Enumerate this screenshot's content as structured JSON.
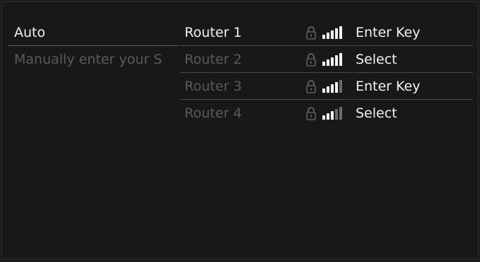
{
  "left_menu": {
    "items": [
      {
        "label": "Auto"
      },
      {
        "label": "Manually enter your S"
      }
    ]
  },
  "networks": [
    {
      "name": "Router 1",
      "action": "Enter Key",
      "locked": true,
      "signal_bars": 5
    },
    {
      "name": "Router 2",
      "action": "Select",
      "locked": true,
      "signal_bars": 5
    },
    {
      "name": "Router 3",
      "action": "Enter Key",
      "locked": true,
      "signal_bars": 4
    },
    {
      "name": "Router 4",
      "action": "Select",
      "locked": true,
      "signal_bars": 3
    }
  ],
  "icons": {
    "lock": "lock-icon",
    "signal": "signal-strength-icon"
  },
  "colors": {
    "background": "#181818",
    "text_active": "#f2f2f2",
    "text_dim": "#5a5a5a",
    "divider": "#4a4a4a"
  }
}
